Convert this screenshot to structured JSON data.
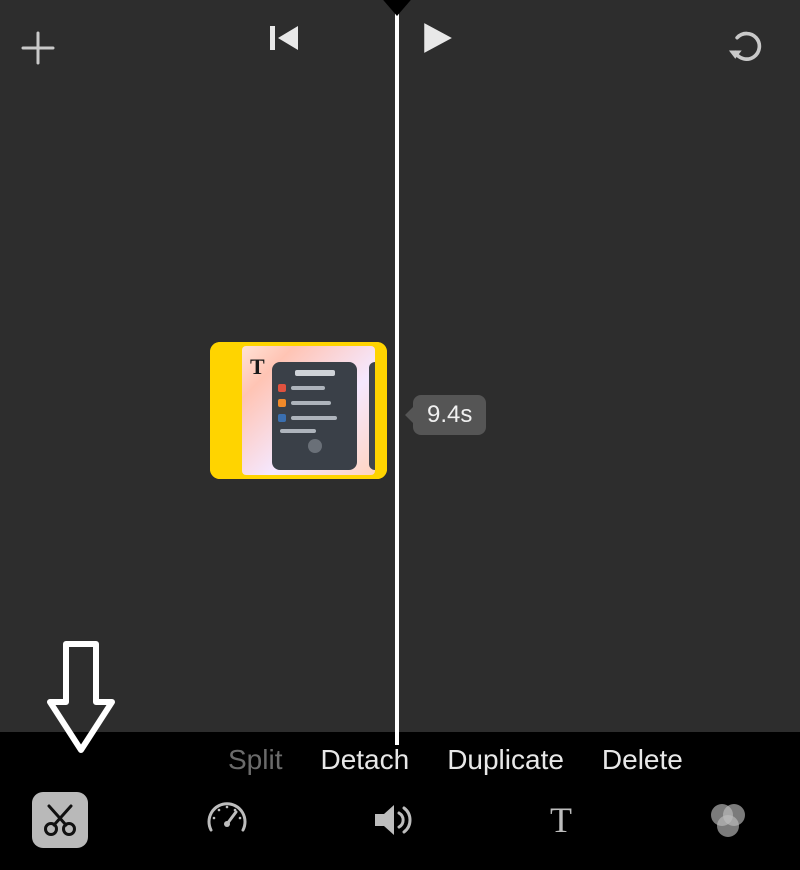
{
  "clip": {
    "title_badge": "T",
    "duration_label": "9.4s"
  },
  "actions": {
    "split": "Split",
    "detach": "Detach",
    "duplicate": "Duplicate",
    "delete": "Delete"
  },
  "icons": {
    "add": "plus-icon",
    "skip_back": "skip-back-icon",
    "play": "play-icon",
    "undo": "undo-icon",
    "cut": "scissors-icon",
    "speed": "speedometer-icon",
    "volume": "speaker-icon",
    "text": "text-icon",
    "filters": "filters-icon"
  }
}
